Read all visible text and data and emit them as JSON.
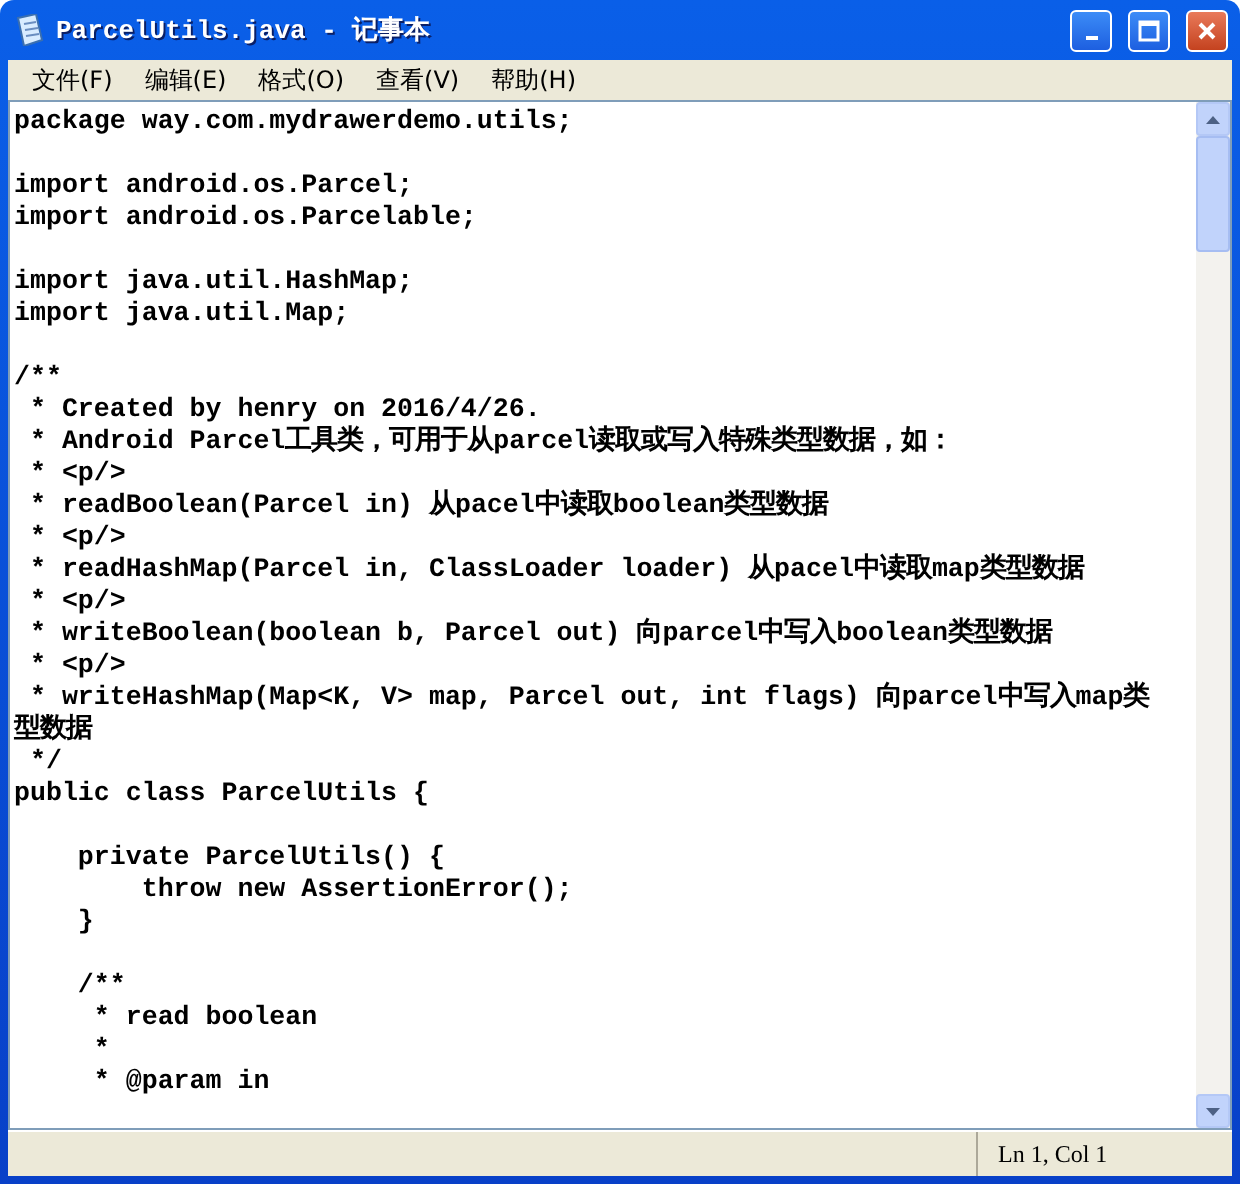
{
  "window": {
    "title": "ParcelUtils.java - 记事本"
  },
  "menu": [
    {
      "label": "文件(F)"
    },
    {
      "label": "编辑(E)"
    },
    {
      "label": "格式(O)"
    },
    {
      "label": "查看(V)"
    },
    {
      "label": "帮助(H)"
    }
  ],
  "text": "package way.com.mydrawerdemo.utils;\n\nimport android.os.Parcel;\nimport android.os.Parcelable;\n\nimport java.util.HashMap;\nimport java.util.Map;\n\n/**\n * Created by henry on 2016/4/26.\n * Android Parcel工具类，可用于从parcel读取或写入特殊类型数据，如：\n * <p/>\n * readBoolean(Parcel in) 从pacel中读取boolean类型数据\n * <p/>\n * readHashMap(Parcel in, ClassLoader loader) 从pacel中读取map类型数据\n * <p/>\n * writeBoolean(boolean b, Parcel out) 向parcel中写入boolean类型数据\n * <p/>\n * writeHashMap(Map<K, V> map, Parcel out, int flags) 向parcel中写入map类型数据\n */\npublic class ParcelUtils {\n\n    private ParcelUtils() {\n        throw new AssertionError();\n    }\n\n    /**\n     * read boolean\n     *\n     * @param in",
  "status_bar": {
    "position": "Ln 1, Col 1"
  }
}
